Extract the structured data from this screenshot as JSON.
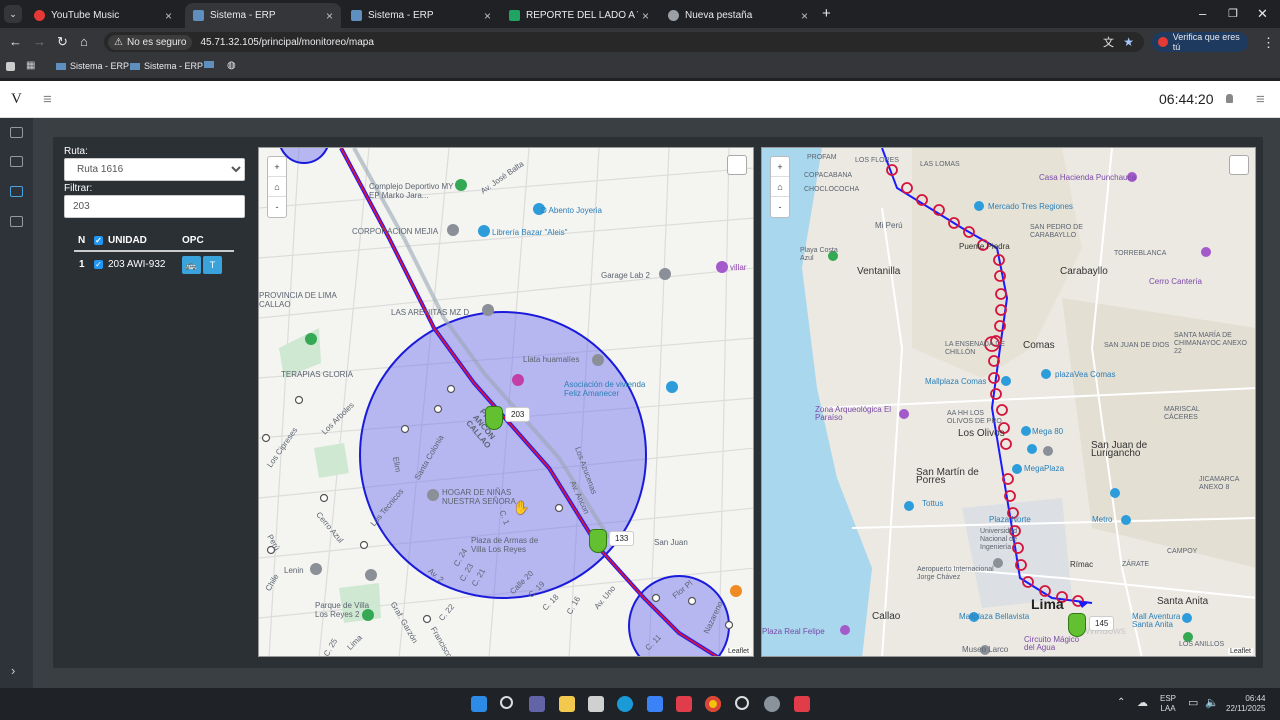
{
  "browser": {
    "tabs": [
      {
        "label": "YouTube Music",
        "color": "#e53935"
      },
      {
        "label": "Sistema - ERP",
        "color": "#5f8fbf"
      },
      {
        "label": "Sistema - ERP",
        "color": "#5f8fbf"
      },
      {
        "label": "REPORTE DEL LADO A VIPUSA",
        "color": "#1fa463"
      },
      {
        "label": "Nueva pestaña",
        "color": "#9aa0a6"
      }
    ],
    "new_tab": "+",
    "security_label": "No es seguro",
    "url": "45.71.32.105/principal/monitoreo/mapa",
    "profile_label": "Verifica que eres tú",
    "bookmarks": [
      "Sistema - ERP",
      "Sistema - ERP"
    ]
  },
  "app": {
    "logo": "V",
    "clock": "06:44:20"
  },
  "filters": {
    "ruta_label": "Ruta:",
    "ruta_value": "Ruta 1616",
    "filtrar_label": "Filtrar:",
    "filtrar_value": "203"
  },
  "table": {
    "headers": [
      "N",
      "UNIDAD",
      "OPC"
    ],
    "rows": [
      {
        "n": "1",
        "unidad": "203 AWI-932",
        "btn1": "🚌",
        "btn2": "T"
      }
    ]
  },
  "map_left": {
    "zoom": [
      "+",
      "⌂",
      "-"
    ],
    "attribution": "Leaflet",
    "vehicles": [
      {
        "label": "203"
      },
      {
        "label": "133"
      }
    ],
    "labels": [
      "Av. José Balta",
      "Complejo Deportivo MY EP Marko Jara...",
      "D Abento Joyeria",
      "CORPORACION MEJIA",
      "Librería Bazar \"Aleis\"",
      "Garage Lab 2",
      "villar",
      "PROVINCIA DE LIMA CALLAO",
      "LAS ARENITAS MZ D",
      "Llata huamalíes",
      "Asociación de vivienda Feliz Amanecer",
      "TERAPIAS GLORIA",
      "Los Arboles",
      "Los Cipreses",
      "Santa Colonia",
      "Elim",
      "HOGAR DE NIÑAS NUESTRA SEÑORA",
      "Los Tecnicos",
      "Av. Ancon",
      "Los Azucenas",
      "San Juan",
      "Cerro Azul",
      "Perú",
      "Lenin",
      "Plaza de Armas de Villa Los Reyes",
      "Parque de Villa Los Reyes 2",
      "Graf. Garzón",
      "Nazareno",
      "Francisco",
      "C. 24",
      "C. 23",
      "C. 21",
      "Calle 20",
      "C. 19",
      "C. 18",
      "C. 16",
      "C. 11",
      "Av. Uno",
      "Lima",
      "Chile",
      "Av. 2",
      "C. 25",
      "C. 1",
      "C. 22",
      "PROV. ANCON CALLAO",
      "Flor Pl"
    ]
  },
  "map_right": {
    "zoom": [
      "+",
      "⌂",
      "-"
    ],
    "attribution": "Leaflet",
    "vehicles": [
      {
        "label": "145"
      }
    ],
    "labels": [
      "PROFAM",
      "LOS FLORES",
      "LAS LOMAS",
      "COPACABANA",
      "CHOCLOCOCHA",
      "Casa Hacienda Punchauca",
      "Mi Perú",
      "Mercado Tres Regiones",
      "SAN PEDRO DE CARABAYLLO",
      "Playa Costa Azul",
      "Ventanilla",
      "Puente Piedra",
      "TORREBLANCA",
      "Cerro Cantería",
      "Carabayllo",
      "LA ENSENADA DE CHILLÓN",
      "Comas",
      "SAN JUAN DE DIOS",
      "SANTA MARÍA DE CHIMANAYOC ANEXO 22",
      "Mallplaza Comas",
      "plazaVea Comas",
      "Zona Arqueológica El Paraíso",
      "AA HH LOS OLIVOS DE PRO",
      "Los Olivos",
      "Mega 80",
      "MARISCAL CÁCERES",
      "San Juan de Lurigancho",
      "San Martín de Porres",
      "Tottus",
      "MegaPlaza",
      "JICAMARCA ANEXO 8",
      "Plaza Norte",
      "Metro",
      "Universidad Nacional de Ingeniería",
      "Aeropuerto Internacional Jorge Chávez",
      "CAMPOY",
      "ZÁRATE",
      "Rímac",
      "Callao",
      "Mallplaza Bellavista",
      "Lima",
      "Santa Anita",
      "Mall Aventura Santa Anita",
      "Plaza Real Felipe",
      "Circuito Mágico del Agua",
      "Museo Larco",
      "LOS ANILLOS",
      "Windows"
    ]
  },
  "taskbar": {
    "lang1": "ESP",
    "lang2": "LAA",
    "time": "06:44",
    "date": "22/11/2025"
  },
  "colors": {
    "route": "#d4143c",
    "route_blue": "#1a1aff",
    "zone_fill": "#6a6af0",
    "zone_stroke": "#1a1adb",
    "vehicle": "#63c030"
  }
}
